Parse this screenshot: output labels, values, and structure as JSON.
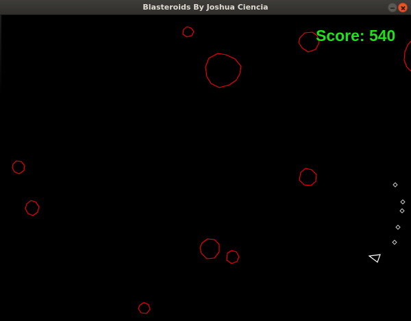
{
  "window": {
    "title": "Blasteroids By Joshua Ciencia",
    "minimize_icon": "minimize-icon",
    "close_icon": "close-icon"
  },
  "hud": {
    "score_text": "Score: 540"
  },
  "colors": {
    "asteroid": "#ff0000",
    "score": "#22e01e",
    "ship": "#ffffff",
    "bullet": "#cccccc",
    "background": "#000000"
  }
}
